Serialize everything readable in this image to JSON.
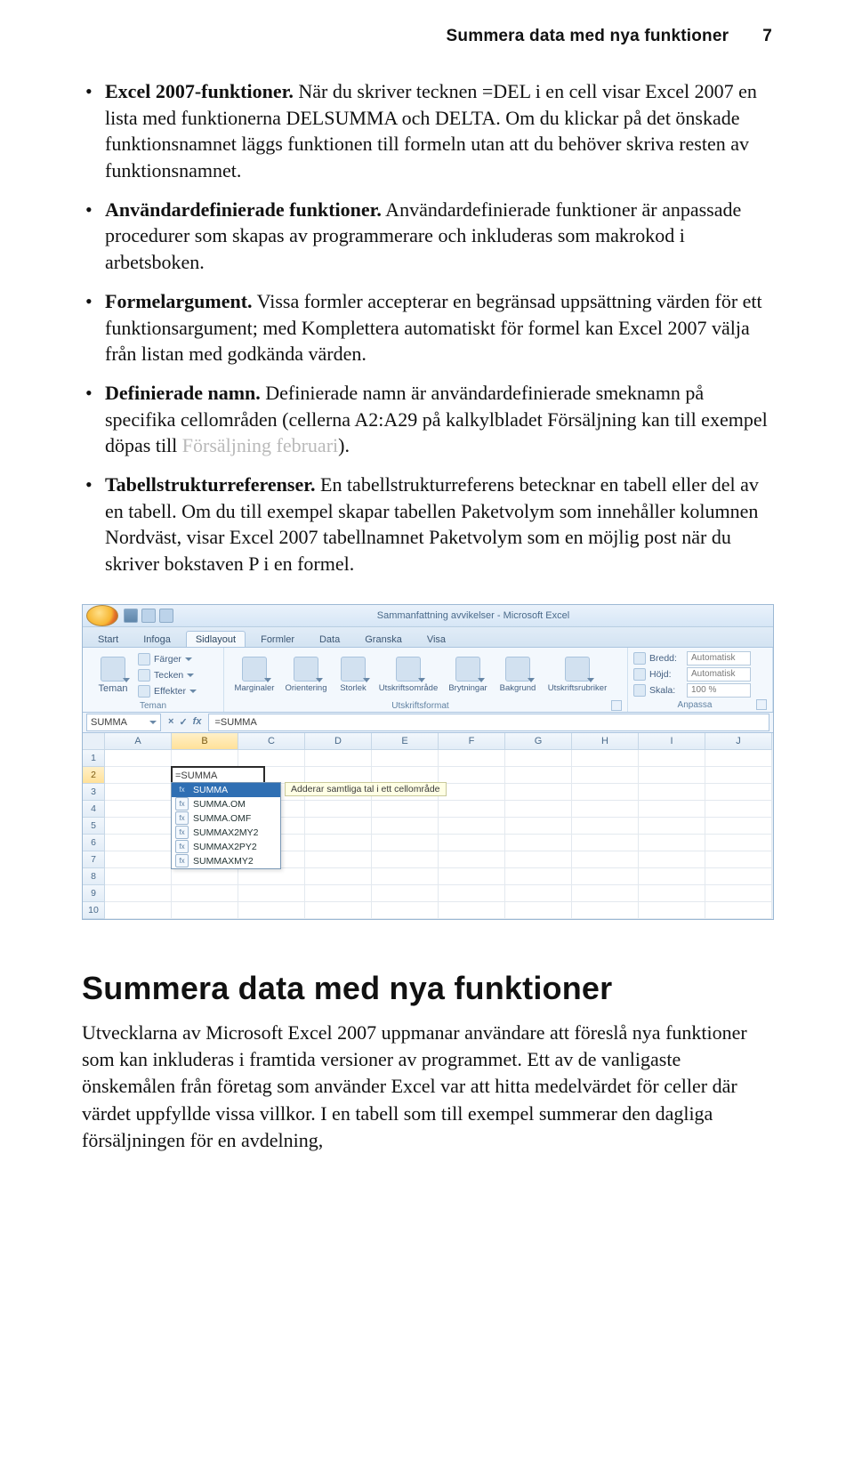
{
  "header": {
    "title": "Summera data med nya funktioner",
    "page_number": "7"
  },
  "bullets": [
    {
      "lead": "Excel 2007-funktioner.",
      "rest": " När du skriver tecknen =DEL i en cell visar Excel 2007 en lista med funktionerna DELSUMMA och DELTA. Om du klickar på det önskade funktionsnamnet läggs funktionen till formeln utan att du behöver skriva resten av funktionsnamnet."
    },
    {
      "lead": "Användardefinierade funktioner.",
      "rest": " Användardefinierade funktioner är anpassade procedurer som skapas av programmerare och inkluderas som makrokod i arbetsboken."
    },
    {
      "lead": "Formelargument.",
      "rest": " Vissa formler accepterar en begränsad uppsättning värden för ett funktionsargument; med Komplettera automatiskt för formel kan Excel 2007 välja från listan med godkända värden."
    },
    {
      "lead": "Definierade namn.",
      "rest_pre": " Definierade namn är användardefinierade smeknamn på specifika cellområden (cellerna A2:A29 på kalkylbladet Försäljning kan till exempel döpas till ",
      "ghost": "Försäljning februari",
      "rest_post": ")."
    },
    {
      "lead": "Tabellstrukturreferenser.",
      "rest": " En tabellstrukturreferens betecknar en tabell eller del av en tabell. Om du till exempel skapar tabellen Paketvolym som innehåller kolumnen Nordväst, visar Excel 2007 tabellnamnet Paketvolym som en möjlig post när du skriver bokstaven P i en formel."
    }
  ],
  "excel": {
    "title": "Sammanfattning avvikelser - Microsoft Excel",
    "tabs": [
      "Start",
      "Infoga",
      "Sidlayout",
      "Formler",
      "Data",
      "Granska",
      "Visa"
    ],
    "active_tab": "Sidlayout",
    "groups": {
      "teman": {
        "big": "Teman",
        "mini": [
          "Färger",
          "Tecken",
          "Effekter"
        ],
        "label": "Teman"
      },
      "utskrift": {
        "bigs": [
          "Marginaler",
          "Orientering",
          "Storlek",
          "Utskriftsområde",
          "Brytningar",
          "Bakgrund",
          "Utskriftsrubriker"
        ],
        "label": "Utskriftsformat"
      },
      "anpassa": {
        "rows": [
          {
            "lbl": "Bredd:",
            "val": "Automatisk"
          },
          {
            "lbl": "Höjd:",
            "val": "Automatisk"
          },
          {
            "lbl": "Skala:",
            "val": "100 %"
          }
        ],
        "label": "Anpassa"
      }
    },
    "name_box": "SUMMA",
    "fb_icons": {
      "cancel": "×",
      "enter": "✓",
      "fx": "fx"
    },
    "formula": "=SUMMA",
    "columns": [
      "A",
      "B",
      "C",
      "D",
      "E",
      "F",
      "G",
      "H",
      "I",
      "J"
    ],
    "rows": [
      "1",
      "2",
      "3",
      "4",
      "5",
      "6",
      "7",
      "8",
      "9",
      "10"
    ],
    "active_col": "B",
    "active_row": "2",
    "edit_value": "=SUMMA",
    "ac": [
      "SUMMA",
      "SUMMA.OM",
      "SUMMA.OMF",
      "SUMMAX2MY2",
      "SUMMAX2PY2",
      "SUMMAXMY2"
    ],
    "ac_selected": 0,
    "tooltip": "Adderar samtliga tal i ett cellområde"
  },
  "section": {
    "heading": "Summera data med nya funktioner",
    "body": "Utvecklarna av Microsoft Excel 2007 uppmanar användare att föreslå nya funktioner som kan inkluderas i framtida versioner av programmet. Ett av de vanligaste önskemålen från företag som använder Excel var att hitta medelvärdet för celler där värdet uppfyllde vissa villkor. I en tabell som till exempel summerar den dagliga försäljningen för en avdelning,"
  }
}
